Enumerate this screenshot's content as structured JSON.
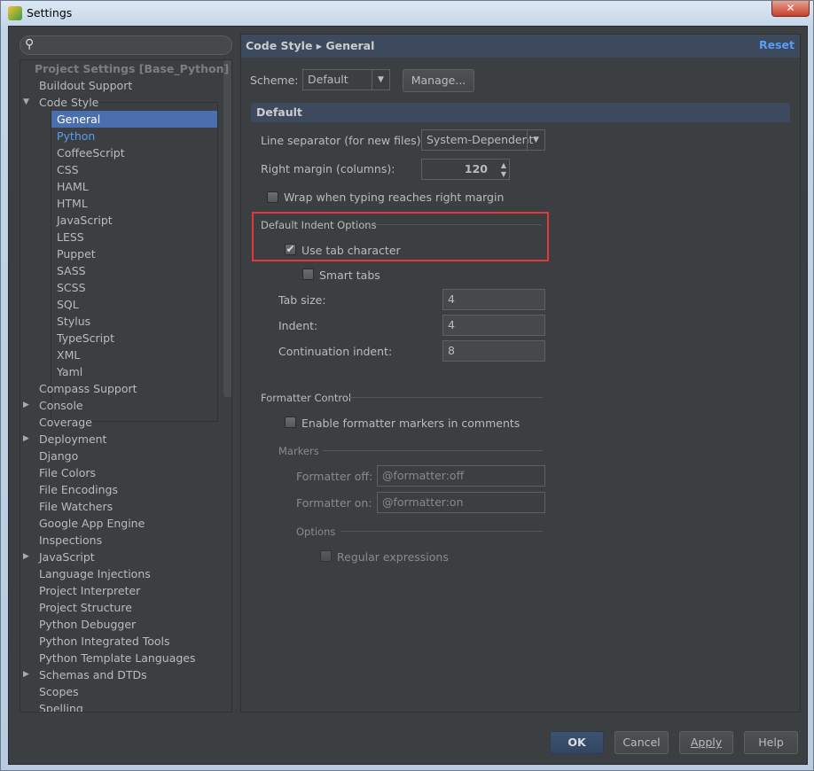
{
  "window": {
    "title": "Settings",
    "close": "✕"
  },
  "search": {
    "icon": "search-icon",
    "value": ""
  },
  "tree": {
    "header": "Project Settings [Base_Python]",
    "items": [
      {
        "label": "Buildout Support"
      },
      {
        "label": "Code Style",
        "expanded": true
      },
      {
        "label": "General",
        "selected": true
      },
      {
        "label": "Python"
      },
      {
        "label": "CoffeeScript"
      },
      {
        "label": "CSS"
      },
      {
        "label": "HAML"
      },
      {
        "label": "HTML"
      },
      {
        "label": "JavaScript"
      },
      {
        "label": "LESS"
      },
      {
        "label": "Puppet"
      },
      {
        "label": "SASS"
      },
      {
        "label": "SCSS"
      },
      {
        "label": "SQL"
      },
      {
        "label": "Stylus"
      },
      {
        "label": "TypeScript"
      },
      {
        "label": "XML"
      },
      {
        "label": "Yaml"
      },
      {
        "label": "Compass Support"
      },
      {
        "label": "Console",
        "collapsed": true
      },
      {
        "label": "Coverage"
      },
      {
        "label": "Deployment",
        "collapsed": true
      },
      {
        "label": "Django"
      },
      {
        "label": "File Colors"
      },
      {
        "label": "File Encodings"
      },
      {
        "label": "File Watchers"
      },
      {
        "label": "Google App Engine"
      },
      {
        "label": "Inspections"
      },
      {
        "label": "JavaScript",
        "collapsed": true
      },
      {
        "label": "Language Injections"
      },
      {
        "label": "Project Interpreter"
      },
      {
        "label": "Project Structure"
      },
      {
        "label": "Python Debugger"
      },
      {
        "label": "Python Integrated Tools"
      },
      {
        "label": "Python Template Languages"
      },
      {
        "label": "Schemas and DTDs",
        "collapsed": true
      },
      {
        "label": "Scopes"
      },
      {
        "label": "Spelling"
      }
    ]
  },
  "panel": {
    "breadcrumb": "Code Style ▸ General",
    "reset": "Reset",
    "scheme_label": "Scheme:",
    "scheme_value": "Default",
    "manage": "Manage...",
    "section": "Default",
    "line_sep_label": "Line separator (for new files):",
    "line_sep_value": "System-Dependent",
    "right_margin_label": "Right margin (columns):",
    "right_margin_value": "120",
    "wrap_label": "Wrap when typing reaches right margin",
    "wrap_checked": false,
    "indent_group": "Default Indent Options",
    "use_tab_label": "Use tab character",
    "use_tab_checked": true,
    "smart_tabs_label": "Smart tabs",
    "smart_tabs_checked": false,
    "tab_size_label": "Tab size:",
    "tab_size": "4",
    "indent_label": "Indent:",
    "indent": "4",
    "cont_label": "Continuation indent:",
    "cont": "8",
    "formatter_group": "Formatter Control",
    "enable_markers_label": "Enable formatter markers in comments",
    "markers_group": "Markers",
    "off_label": "Formatter off:",
    "off_value": "@formatter:off",
    "on_label": "Formatter on:",
    "on_value": "@formatter:on",
    "options_group": "Options",
    "regex_label": "Regular expressions"
  },
  "buttons": {
    "ok": "OK",
    "cancel": "Cancel",
    "apply": "Apply",
    "help": "Help"
  }
}
